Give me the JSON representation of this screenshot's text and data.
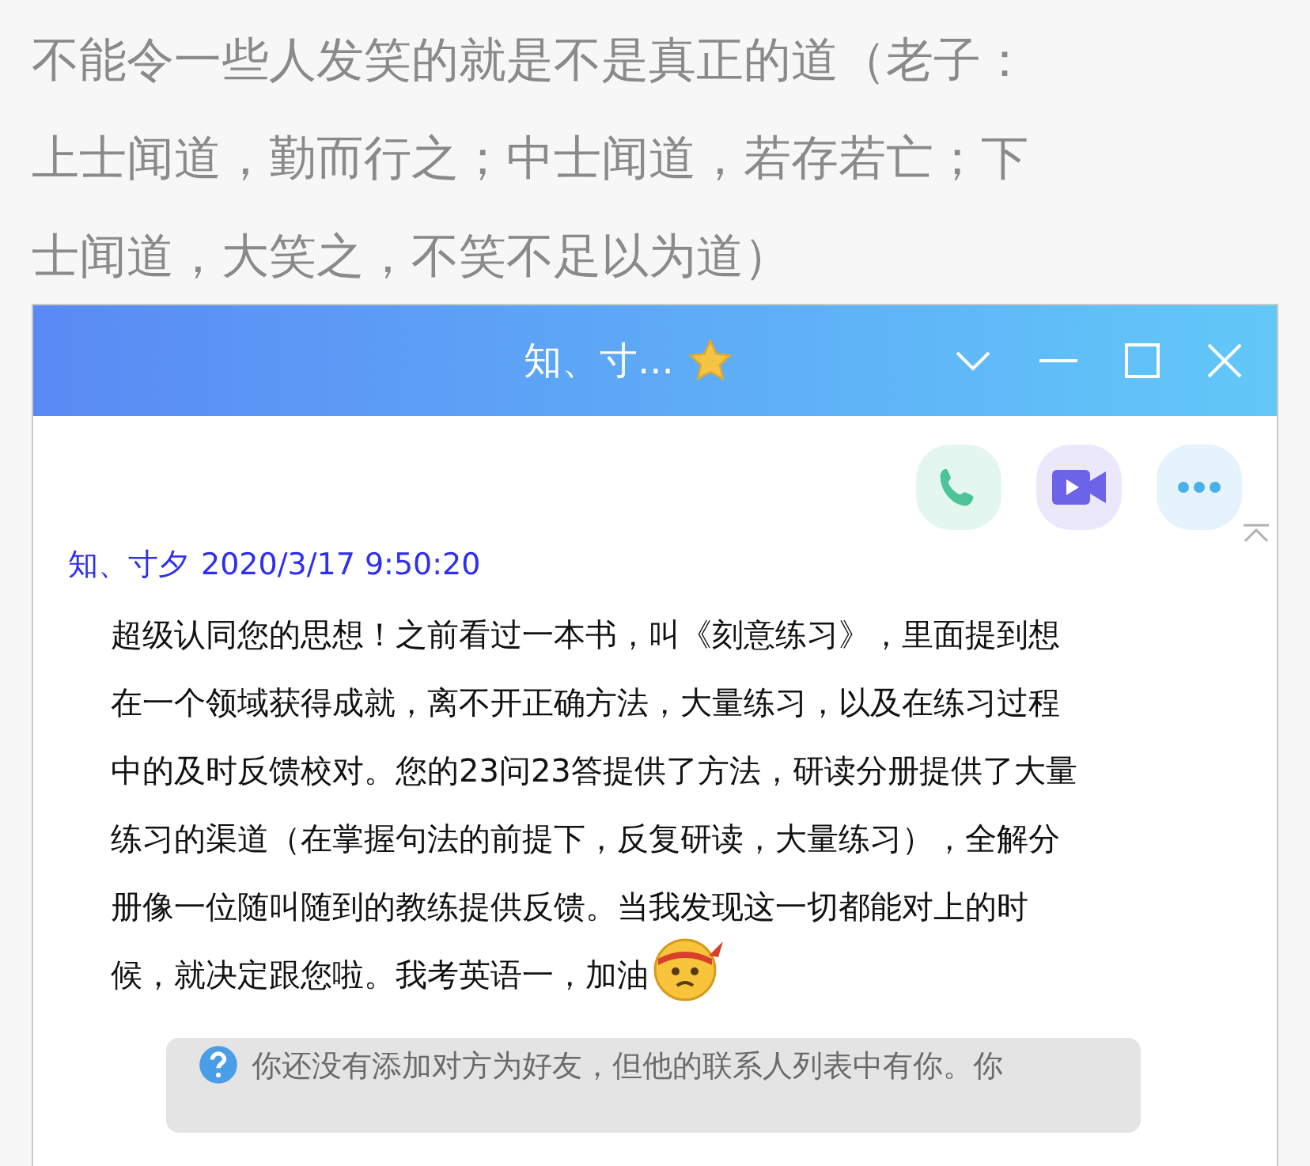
{
  "article": {
    "lines": [
      "不能令一些人发笑的就是不是真正的道（老子：",
      "上士闻道，勤而行之；中士闻道，若存若亡；下",
      "士闻道，大笑之，不笑不足以为道）"
    ]
  },
  "window": {
    "title": "知、寸..."
  },
  "message": {
    "sender": "知、寸夕",
    "time": "2020/3/17 9:50:20",
    "lines": [
      "超级认同您的思想！之前看过一本书，叫《刻意练习》，里面提到想",
      "在一个领域获得成就，离不开正确方法，大量练习，以及在练习过程",
      "中的及时反馈校对。您的23问23答提供了方法，研读分册提供了大量",
      "练习的渠道（在掌握句法的前提下，反复研读，大量练习），全解分",
      "册像一位随叫随到的教练提供反馈。当我发现这一切都能对上的时",
      "候，就决定跟您啦。我考英语一，加油"
    ]
  },
  "notice": {
    "text": "你还没有添加对方为好友，但他的联系人列表中有你。你"
  }
}
